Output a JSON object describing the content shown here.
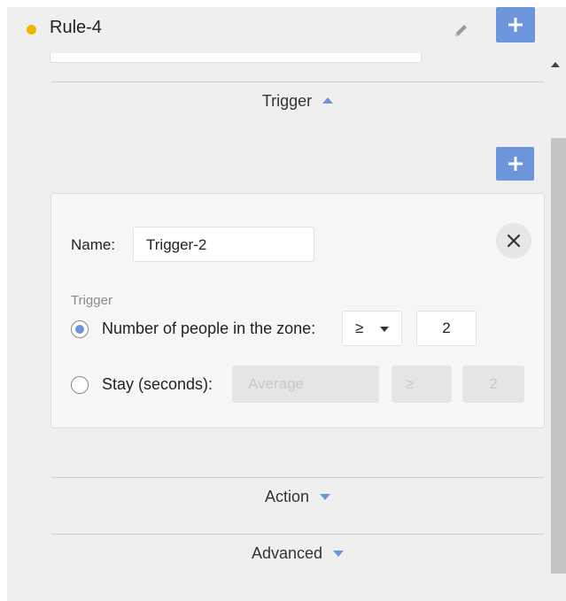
{
  "rule": {
    "title": "Rule-4",
    "status_color": "#f2b400"
  },
  "header": {
    "edit_icon": "pencil-icon",
    "add_icon": "plus-icon"
  },
  "sections": {
    "trigger": {
      "label": "Trigger",
      "expanded": true
    },
    "action": {
      "label": "Action",
      "expanded": false
    },
    "advanced": {
      "label": "Advanced",
      "expanded": false
    }
  },
  "trigger_card": {
    "name_label": "Name:",
    "name_value": "Trigger-2",
    "group_label": "Trigger",
    "options": [
      {
        "label": "Number of people in the zone:",
        "selected": true,
        "operator": "≥",
        "value": "2"
      },
      {
        "label": "Stay (seconds):",
        "selected": false,
        "aggregate_placeholder": "Average",
        "operator": "≥",
        "value": "2"
      }
    ]
  },
  "colors": {
    "accent": "#6d95dc",
    "status": "#f2b400"
  }
}
